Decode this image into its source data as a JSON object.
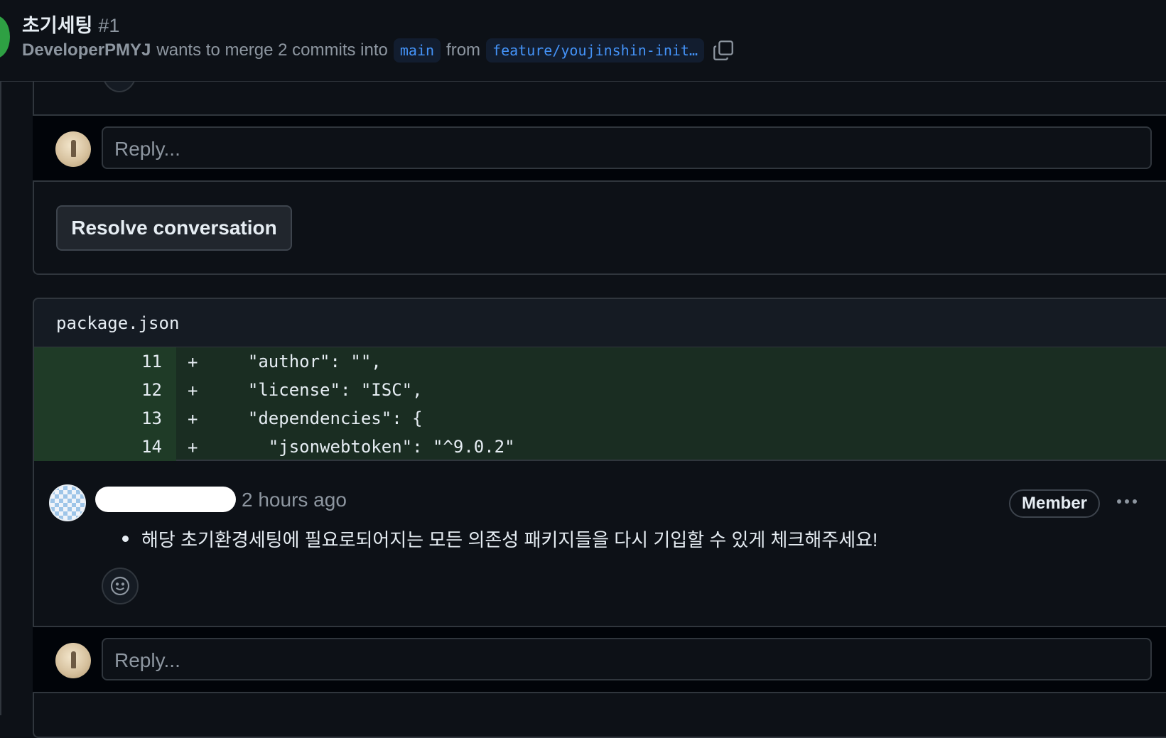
{
  "header": {
    "title": "초기세팅",
    "number": "#1",
    "author": "DeveloperPMYJ",
    "merge_text": "wants to merge 2 commits into",
    "base_branch": "main",
    "from_text": "from",
    "head_branch": "feature/youjinshin-init…",
    "copy_icon": "copy-icon"
  },
  "thread1": {
    "reply_placeholder": "Reply...",
    "resolve_label": "Resolve conversation"
  },
  "thread2": {
    "file_name": "package.json",
    "diff_lines": [
      {
        "num": "11",
        "sign": "+",
        "code": "  \"author\": \"\","
      },
      {
        "num": "12",
        "sign": "+",
        "code": "  \"license\": \"ISC\","
      },
      {
        "num": "13",
        "sign": "+",
        "code": "  \"dependencies\": {"
      },
      {
        "num": "14",
        "sign": "+",
        "code": "    \"jsonwebtoken\": \"^9.0.2\""
      }
    ],
    "comment": {
      "time": "2 hours ago",
      "badge": "Member",
      "body": "해당 초기환경세팅에 필요로되어지는 모든 의존성 패키지들을 다시 기입할 수 있게 체크해주세요!"
    },
    "reply_placeholder": "Reply..."
  },
  "colors": {
    "background": "#0d1117",
    "border": "#30363d",
    "diff_added": "#1a2d22",
    "link": "#4493f8"
  }
}
